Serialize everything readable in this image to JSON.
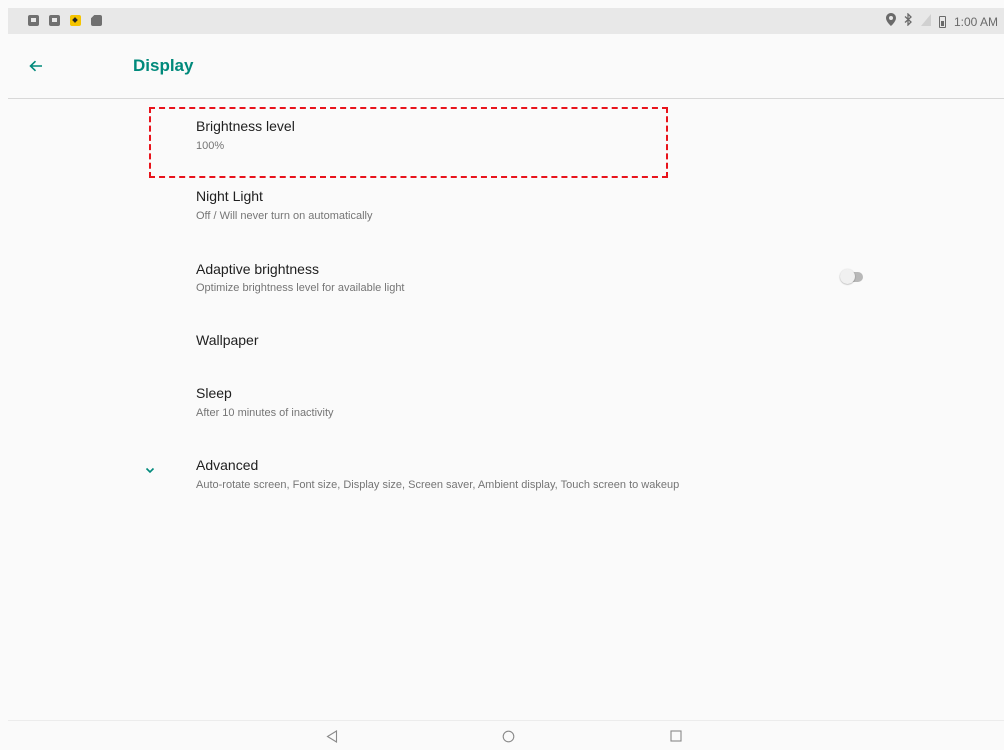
{
  "status_bar": {
    "time": "1:00 AM",
    "left_icons": [
      "photo-icon",
      "gallery-icon",
      "notification-app-icon",
      "sd-card-icon"
    ],
    "right_icons": [
      "location-icon",
      "bluetooth-icon",
      "no-sim-icon",
      "battery-icon"
    ]
  },
  "app_bar": {
    "back_icon": "arrow-back-icon",
    "title": "Display",
    "accent_color": "#00897b"
  },
  "settings": {
    "brightness": {
      "title": "Brightness level",
      "summary": "100%"
    },
    "night_light": {
      "title": "Night Light",
      "summary": "Off / Will never turn on automatically"
    },
    "adaptive_brightness": {
      "title": "Adaptive brightness",
      "summary": "Optimize brightness level for available light",
      "enabled": false
    },
    "wallpaper": {
      "title": "Wallpaper"
    },
    "sleep": {
      "title": "Sleep",
      "summary": "After 10 minutes of inactivity"
    },
    "advanced": {
      "title": "Advanced",
      "summary": "Auto-rotate screen, Font size, Display size, Screen saver, Ambient display, Touch screen to wakeup",
      "icon": "chevron-down-icon"
    }
  },
  "annotation": {
    "highlight_color": "#e8131b"
  },
  "nav_bar": {
    "icons": [
      "back-triangle-icon",
      "home-circle-icon",
      "recents-square-icon"
    ]
  }
}
